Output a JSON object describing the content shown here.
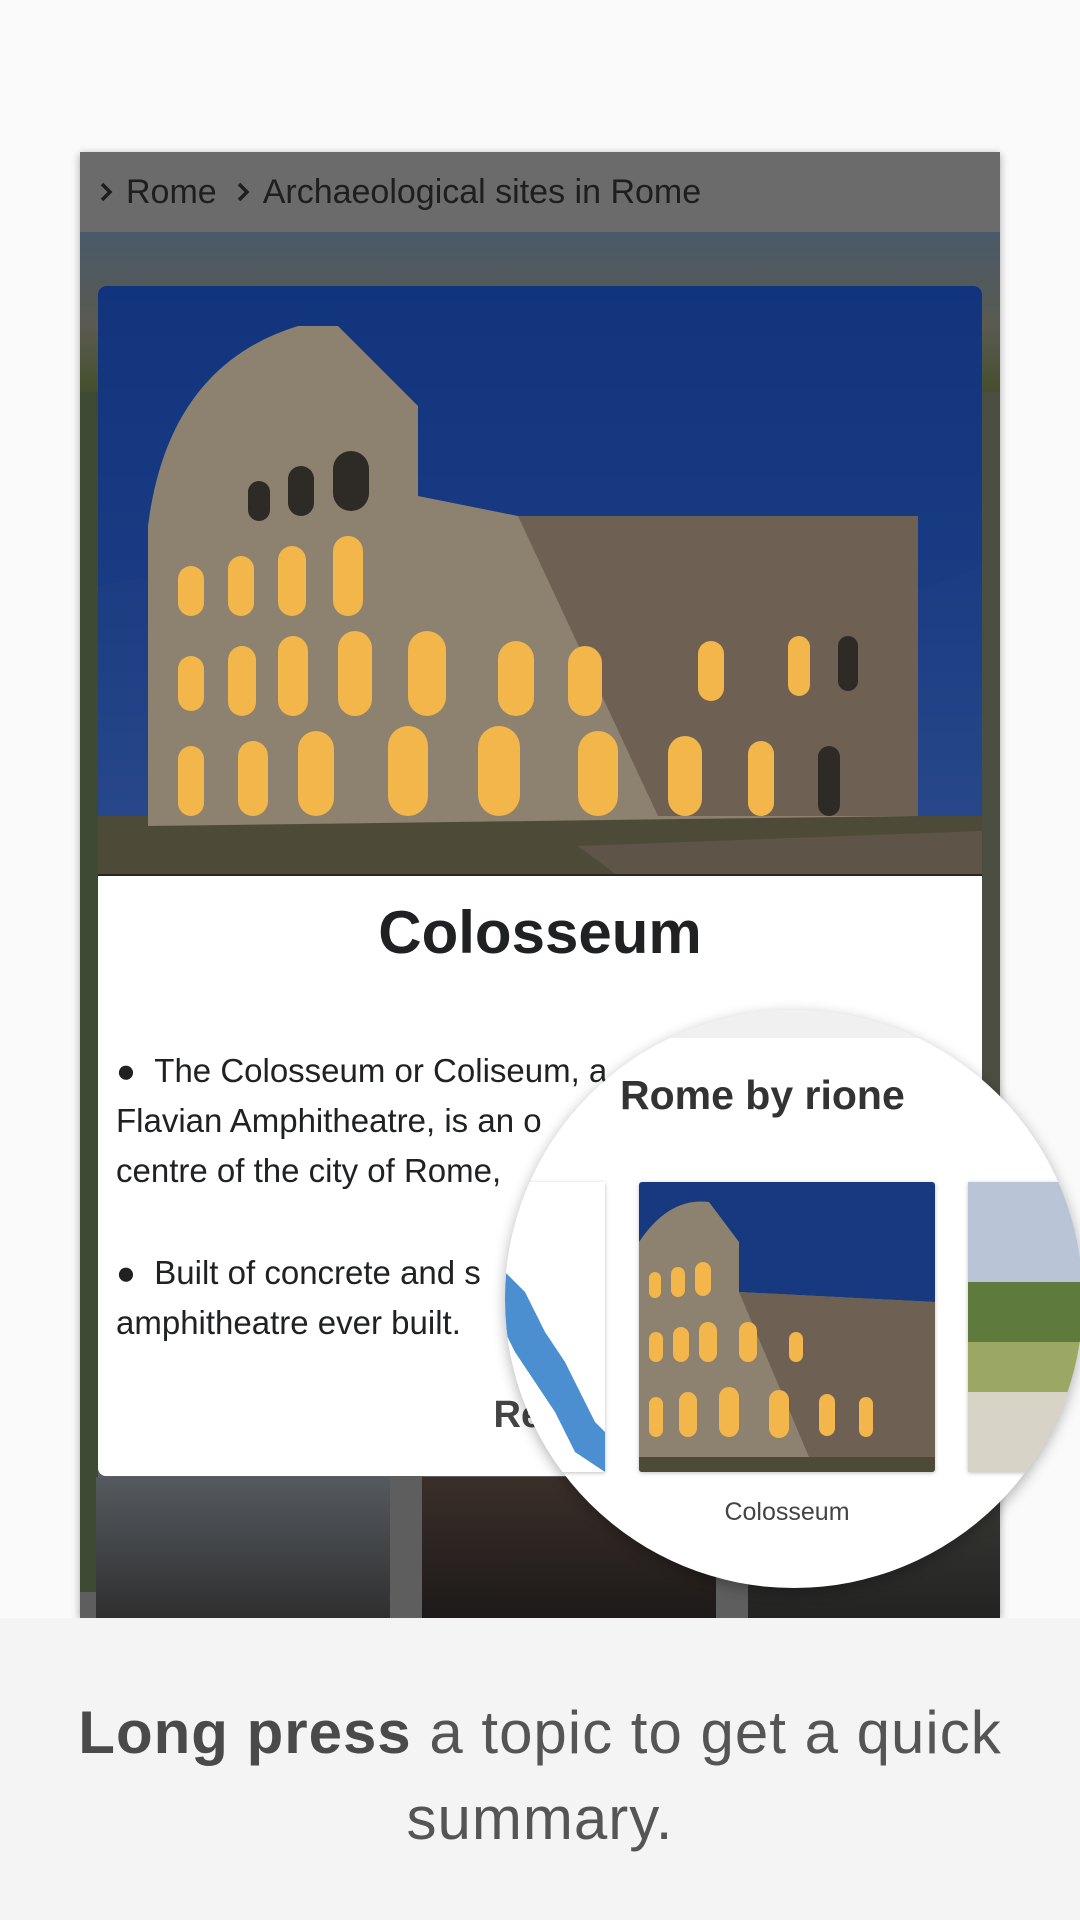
{
  "breadcrumb": [
    "Rome",
    "Archaeological sites in Rome"
  ],
  "card": {
    "title": "Colosseum",
    "bullets": [
      "The Colosseum or Coliseum, a",
      "Built of concrete and s"
    ],
    "bullet_1_lines": [
      "The Colosseum or Coliseum, a",
      "Flavian Amphitheatre, is an o",
      "centre of the city of Rome,"
    ],
    "bullet_2_lines": [
      "Built of concrete and s",
      "amphitheatre ever built."
    ],
    "read_more_label": "Read"
  },
  "magnifier": {
    "section_title": "Rome by rione",
    "card_caption": "Colosseum"
  },
  "footer": {
    "bold": "Long press",
    "rest": " a topic to get a quick summary."
  },
  "colors": {
    "sky": "#0f2f7a",
    "frame": "#5e5e5e",
    "text": "#202122"
  }
}
